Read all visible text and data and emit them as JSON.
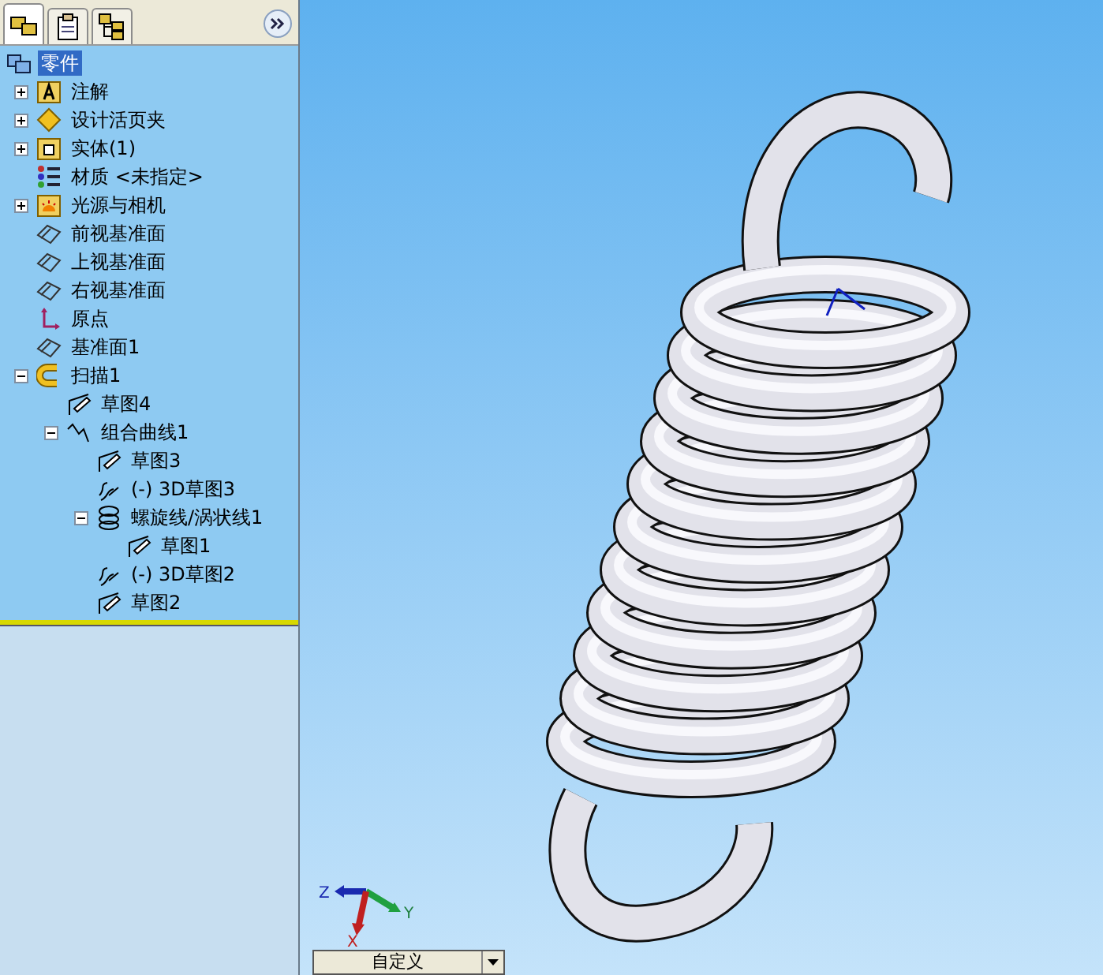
{
  "tabs": [
    {
      "kind": "feature-tree",
      "selected": true
    },
    {
      "kind": "property",
      "selected": false
    },
    {
      "kind": "configuration",
      "selected": false
    }
  ],
  "tree": {
    "label": "零件",
    "kind": "part",
    "selected": true,
    "children": [
      {
        "label": "注解",
        "kind": "annotation",
        "selected": false,
        "expanded": false
      },
      {
        "label": "设计活页夹",
        "kind": "binder",
        "selected": false,
        "expanded": false
      },
      {
        "label": "实体(1)",
        "kind": "body",
        "selected": false,
        "expanded": false
      },
      {
        "label": "材质 <未指定>",
        "kind": "material",
        "selected": false
      },
      {
        "label": "光源与相机",
        "kind": "lights",
        "selected": false,
        "expanded": false
      },
      {
        "label": "前视基准面",
        "kind": "plane",
        "selected": false
      },
      {
        "label": "上视基准面",
        "kind": "plane",
        "selected": false
      },
      {
        "label": "右视基准面",
        "kind": "plane",
        "selected": false
      },
      {
        "label": "原点",
        "kind": "origin",
        "selected": false
      },
      {
        "label": "基准面1",
        "kind": "plane",
        "selected": false
      },
      {
        "label": "扫描1",
        "kind": "sweep",
        "selected": false,
        "expanded": true,
        "children": [
          {
            "label": "草图4",
            "kind": "sketch",
            "selected": false
          },
          {
            "label": "组合曲线1",
            "kind": "curve",
            "selected": false,
            "expanded": true,
            "children": [
              {
                "label": "草图3",
                "kind": "sketch",
                "selected": false
              },
              {
                "label": "(-) 3D草图3",
                "kind": "sketch3d",
                "selected": false
              },
              {
                "label": "螺旋线/涡状线1",
                "kind": "helix",
                "selected": false,
                "expanded": true,
                "children": [
                  {
                    "label": "草图1",
                    "kind": "sketch",
                    "selected": false
                  }
                ]
              },
              {
                "label": "(-) 3D草图2",
                "kind": "sketch3d",
                "selected": false
              },
              {
                "label": "草图2",
                "kind": "sketch",
                "selected": false
              }
            ]
          }
        ]
      }
    ]
  },
  "triad": {
    "labels": [
      "Z",
      "Y",
      "X"
    ]
  },
  "view_orientation": {
    "value": "自定义"
  }
}
